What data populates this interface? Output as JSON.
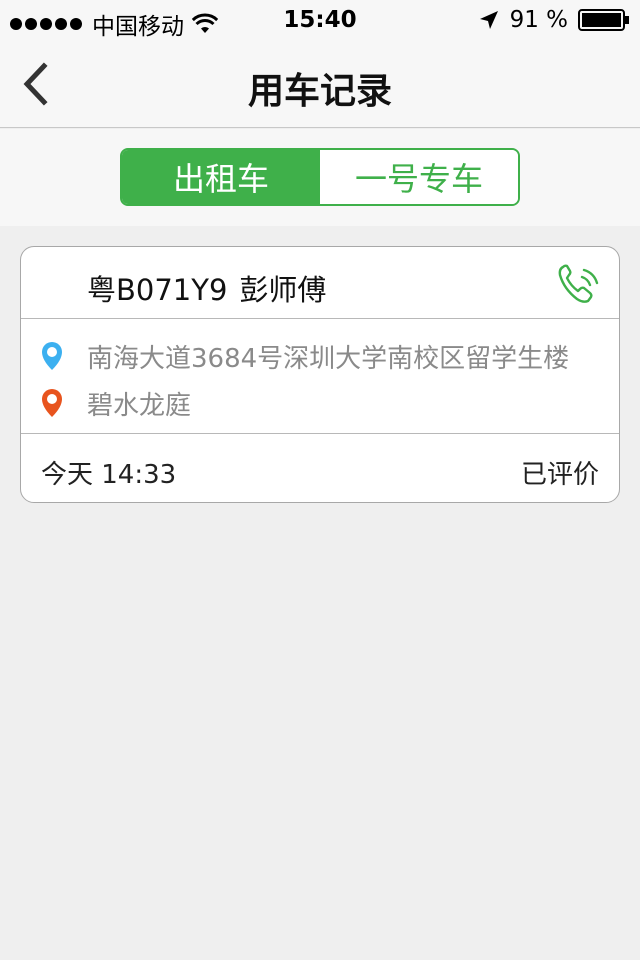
{
  "status_bar": {
    "carrier": "中国移动",
    "time": "15:40",
    "battery": "91 %",
    "icons": [
      "signal-dots",
      "wifi-icon",
      "location-arrow-icon",
      "battery-icon"
    ]
  },
  "nav": {
    "title": "用车记录",
    "back_icon": "chevron-left-icon"
  },
  "tabs": [
    {
      "label": "出租车",
      "active": true
    },
    {
      "label": "一号专车",
      "active": false
    }
  ],
  "colors": {
    "accent": "#3fb04a",
    "start_pin": "#3cb0f0",
    "end_pin": "#e8541e",
    "route_text": "#8a8a8a"
  },
  "records": [
    {
      "plate": "粤B071Y9",
      "driver": "彭师傅",
      "start": "南海大道3684号深圳大学南校区留学生楼",
      "end": "碧水龙庭",
      "time": "今天 14:33",
      "status": "已评价",
      "phone_icon": "phone-icon"
    }
  ]
}
